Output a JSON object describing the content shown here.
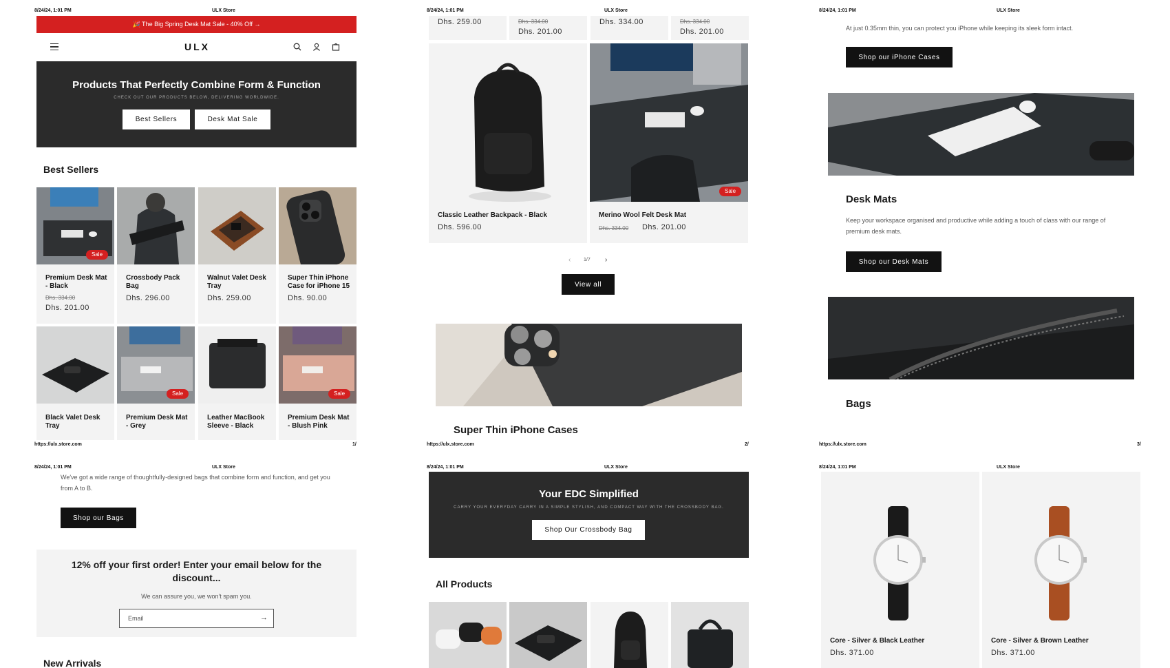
{
  "print": {
    "date": "8/24/24, 1:01 PM",
    "title": "ULX Store",
    "url": "https://ulx.store.com",
    "page1": "1/",
    "page2": "2/",
    "page3": "3/"
  },
  "announcement": {
    "text": "🎉 The Big Spring Desk Mat Sale - 40% Off →",
    "color": "#d42020"
  },
  "header": {
    "logo": "ULX",
    "menu_icon": "hamburger-icon",
    "icons": [
      "search-icon",
      "account-icon",
      "cart-icon"
    ]
  },
  "hero": {
    "title": "Products That Perfectly Combine Form & Function",
    "subtitle": "CHECK OUT OUR PRODUCTS BELOW, DELIVERING WORLDWIDE.",
    "btn1": "Best Sellers",
    "btn2": "Desk Mat Sale"
  },
  "best_sellers": {
    "title": "Best Sellers",
    "sale_label": "Sale",
    "items": [
      {
        "name": "Premium Desk Mat - Black",
        "old": "Dhs. 334.00",
        "price": "Dhs. 201.00"
      },
      {
        "name": "Crossbody Pack Bag",
        "old": "",
        "price": "Dhs. 296.00"
      },
      {
        "name": "Walnut Valet Desk Tray",
        "old": "",
        "price": "Dhs. 259.00"
      },
      {
        "name": "Super Thin iPhone Case for iPhone 15",
        "old": "",
        "price": "Dhs. 90.00"
      },
      {
        "name": "Black Valet Desk Tray",
        "old": "",
        "price": ""
      },
      {
        "name": "Premium Desk Mat - Grey",
        "old": "",
        "price": ""
      },
      {
        "name": "Leather MacBook Sleeve - Black",
        "old": "",
        "price": ""
      },
      {
        "name": "Premium Desk Mat - Blush Pink",
        "old": "",
        "price": ""
      }
    ]
  },
  "carousel": {
    "top_prices": [
      {
        "old": "",
        "price": "Dhs. 259.00"
      },
      {
        "old": "Dhs. 334.00",
        "price": "Dhs. 201.00"
      },
      {
        "old": "",
        "price": "Dhs. 334.00"
      },
      {
        "old": "Dhs. 334.00",
        "price": "Dhs. 201.00"
      }
    ],
    "items": [
      {
        "name": "Classic Leather Backpack - Black",
        "old": "",
        "price": "Dhs. 596.00"
      },
      {
        "name": "Merino Wool Felt Desk Mat",
        "old": "Dhs. 334.00",
        "price": "Dhs. 201.00"
      }
    ],
    "pager": "1/7",
    "view_all": "View all"
  },
  "iphone": {
    "title": "Super Thin iPhone Cases",
    "text": "At just 0.35mm thin, you can protect you iPhone while keeping its sleek form intact.",
    "btn": "Shop our iPhone Cases"
  },
  "deskmats": {
    "title": "Desk Mats",
    "text": "Keep your workspace organised and productive while adding a touch of class with our range of premium desk mats.",
    "btn": "Shop our Desk Mats"
  },
  "bags": {
    "title": "Bags",
    "text": "We've got a wide range of thoughtfully-designed bags that combine form and function, and get you from A to B.",
    "btn": "Shop our Bags"
  },
  "newsletter": {
    "title": "12% off your first order! Enter your email below for the discount...",
    "text": "We can assure you, we won't spam you.",
    "placeholder": "Email"
  },
  "new_arrivals": {
    "title": "New Arrivals"
  },
  "edc": {
    "title": "Your EDC Simplified",
    "subtitle": "CARRY YOUR EVERYDAY CARRY IN A SIMPLE STYLISH, AND COMPACT WAY WITH THE CROSSBODY BAG.",
    "btn": "Shop Our Crossbody Bag"
  },
  "all_products": {
    "title": "All Products"
  },
  "watches": [
    {
      "name": "Core - Silver & Black Leather",
      "price": "Dhs. 371.00"
    },
    {
      "name": "Core - Silver & Brown Leather",
      "price": "Dhs. 371.00"
    }
  ]
}
